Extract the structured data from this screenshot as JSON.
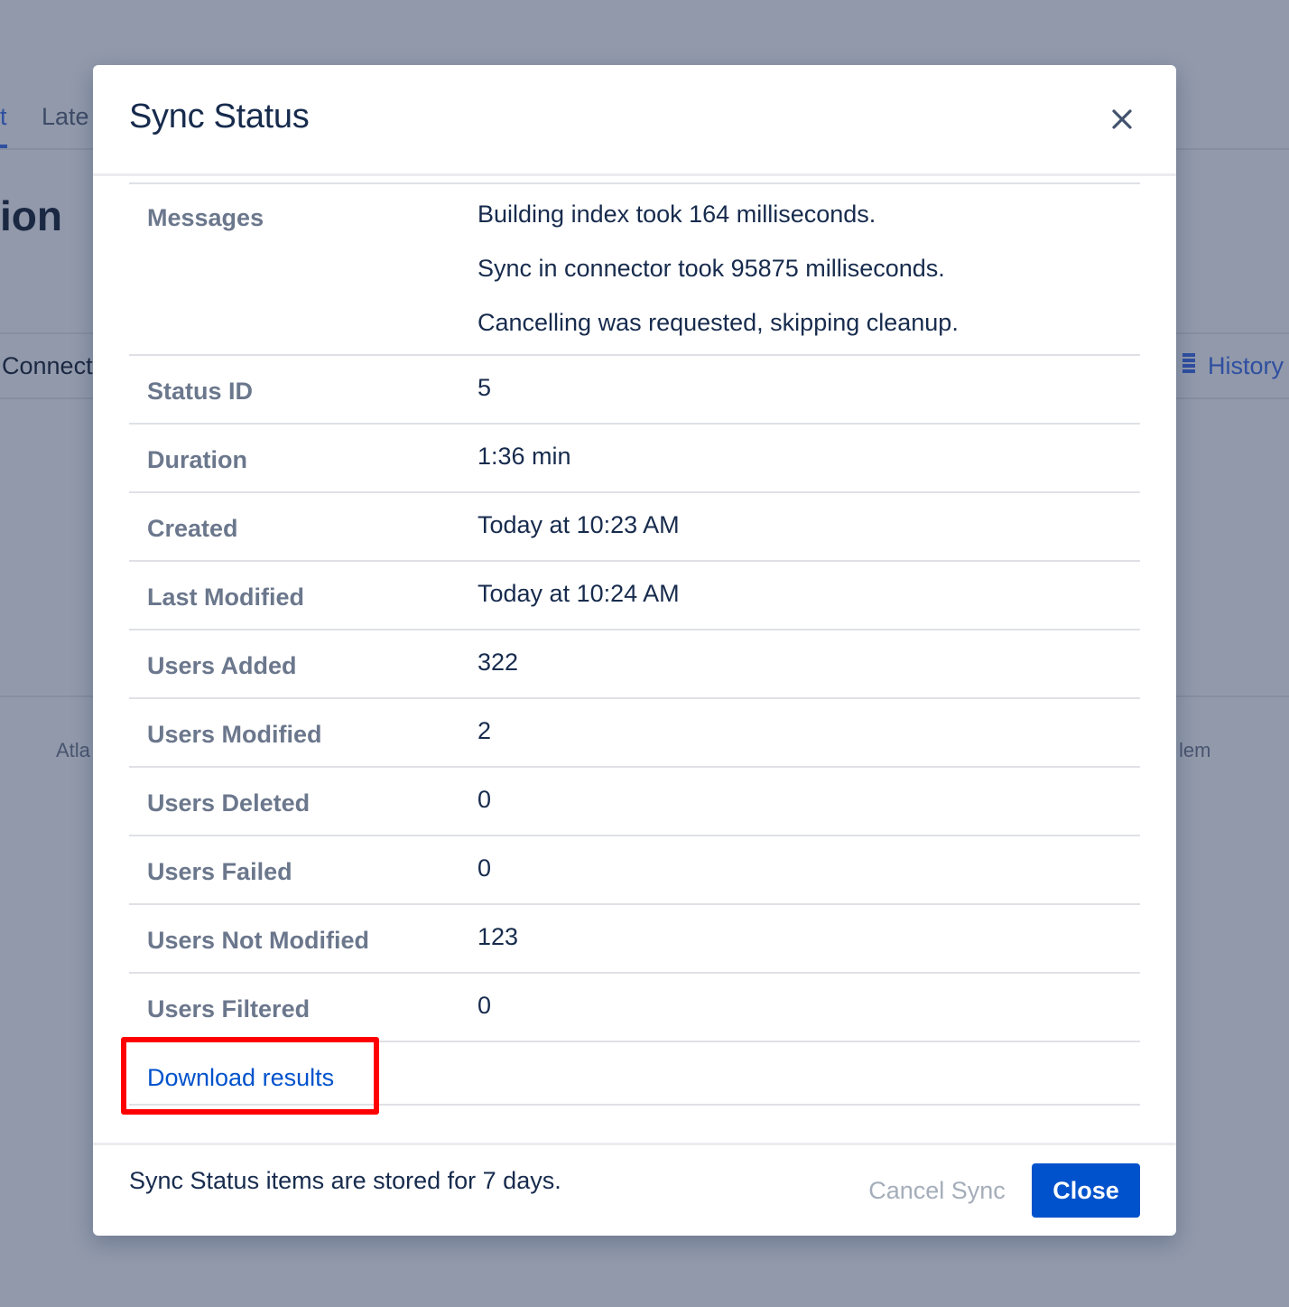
{
  "background": {
    "tabs": [
      "t",
      "Late"
    ],
    "heading": "ion",
    "connect_text": "Connect",
    "history_label": "History",
    "history_icon": "list-icon",
    "footer_left": "Atla",
    "footer_right": "lem",
    "overlay_color": "#9199ab"
  },
  "modal": {
    "title": "Sync Status",
    "close_icon": "close-icon",
    "messages_label": "Messages",
    "messages": [
      "Building index took 164 milliseconds.",
      "Sync in connector took 95875 milliseconds.",
      "Cancelling was requested, skipping cleanup."
    ],
    "rows": [
      {
        "label": "Status ID",
        "value": "5"
      },
      {
        "label": "Duration",
        "value": "1:36 min"
      },
      {
        "label": "Created",
        "value": "Today at 10:23 AM"
      },
      {
        "label": "Last Modified",
        "value": "Today at 10:24 AM"
      },
      {
        "label": "Users Added",
        "value": "322"
      },
      {
        "label": "Users Modified",
        "value": "2"
      },
      {
        "label": "Users Deleted",
        "value": "0"
      },
      {
        "label": "Users Failed",
        "value": "0"
      },
      {
        "label": "Users Not Modified",
        "value": "123"
      },
      {
        "label": "Users Filtered",
        "value": "0"
      }
    ],
    "download_link": "Download results",
    "footer_note": "Sync Status items are stored for 7 days.",
    "cancel_button": "Cancel Sync",
    "close_button": "Close"
  },
  "colors": {
    "primary": "#0052cc",
    "highlight": "#ff0000",
    "label": "#6b778c",
    "text": "#172b4d"
  }
}
